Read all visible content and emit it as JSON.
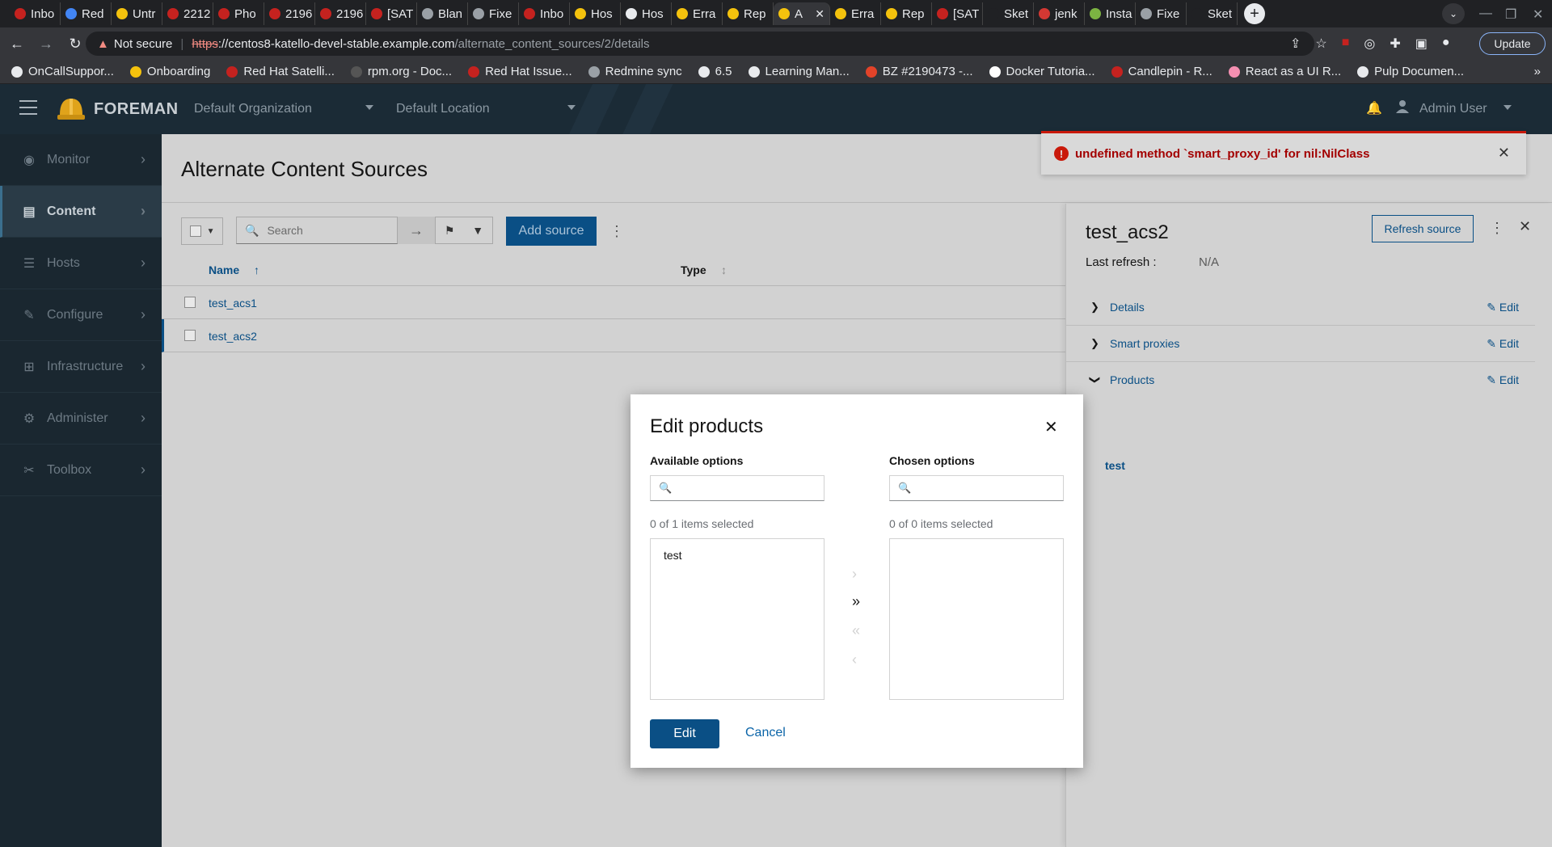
{
  "browser": {
    "tabs": [
      {
        "label": "Inbo",
        "color": "#c5221f"
      },
      {
        "label": "Red",
        "color": "#4285f4"
      },
      {
        "label": "Untr",
        "color": "#f4c20d"
      },
      {
        "label": "2212",
        "color": "#c5221f"
      },
      {
        "label": "Pho",
        "color": "#c5221f"
      },
      {
        "label": "2196",
        "color": "#c5221f"
      },
      {
        "label": "2196",
        "color": "#c5221f"
      },
      {
        "label": "[SAT",
        "color": "#c5221f"
      },
      {
        "label": "Blan",
        "color": "#9aa0a6"
      },
      {
        "label": "Fixe",
        "color": "#9aa0a6"
      },
      {
        "label": "Inbo",
        "color": "#c5221f"
      },
      {
        "label": "Hos",
        "color": "#f4c20d"
      },
      {
        "label": "Hos",
        "color": "#e8eaed"
      },
      {
        "label": "Erra",
        "color": "#f4c20d"
      },
      {
        "label": "Rep",
        "color": "#f4c20d"
      },
      {
        "label": "A",
        "color": "#f4c20d",
        "active": true
      },
      {
        "label": "Erra",
        "color": "#f4c20d"
      },
      {
        "label": "Rep",
        "color": "#f4c20d"
      },
      {
        "label": "[SAT",
        "color": "#c5221f"
      },
      {
        "label": "Sket",
        "color": "#202124"
      },
      {
        "label": "jenk",
        "color": "#d33833"
      },
      {
        "label": "Insta",
        "color": "#7cb342"
      },
      {
        "label": "Fixe",
        "color": "#9aa0a6"
      },
      {
        "label": "Sket",
        "color": "#202124"
      }
    ],
    "new_tab": "+",
    "address": {
      "warning": "Not secure",
      "scheme": "https",
      "host": "://centos8-katello-devel-stable.example.com",
      "path": "/alternate_content_sources/2/details"
    },
    "update_label": "Update",
    "bookmarks": [
      {
        "label": "OnCallSuppor...",
        "color": "#e8eaed"
      },
      {
        "label": "Onboarding",
        "color": "#f4c20d"
      },
      {
        "label": "Red Hat Satelli...",
        "color": "#c5221f"
      },
      {
        "label": "rpm.org - Doc...",
        "color": "#555"
      },
      {
        "label": "Red Hat Issue...",
        "color": "#c5221f"
      },
      {
        "label": "Redmine sync",
        "color": "#9aa0a6"
      },
      {
        "label": "6.5",
        "color": "#e8eaed"
      },
      {
        "label": "Learning Man...",
        "color": "#e8eaed"
      },
      {
        "label": "BZ #2190473 -...",
        "color": "#e24329"
      },
      {
        "label": "Docker Tutoria...",
        "color": "#ffffff"
      },
      {
        "label": "Candlepin - R...",
        "color": "#c5221f"
      },
      {
        "label": "React as a UI R...",
        "color": "#f48fb1"
      },
      {
        "label": "Pulp Documen...",
        "color": "#e8eaed"
      }
    ],
    "bookmarks_more": "»"
  },
  "app": {
    "brand": "FOREMAN",
    "organization": "Default Organization",
    "location": "Default Location",
    "user": "Admin User"
  },
  "sidebar": {
    "items": [
      {
        "label": "Monitor",
        "icon": "dashboard-icon",
        "glyph": "◉"
      },
      {
        "label": "Content",
        "icon": "book-icon",
        "glyph": "▤",
        "active": true
      },
      {
        "label": "Hosts",
        "icon": "server-icon",
        "glyph": "☰"
      },
      {
        "label": "Configure",
        "icon": "wrench-icon",
        "glyph": "✎"
      },
      {
        "label": "Infrastructure",
        "icon": "network-icon",
        "glyph": "⊞"
      },
      {
        "label": "Administer",
        "icon": "gear-icon",
        "glyph": "⚙"
      },
      {
        "label": "Toolbox",
        "icon": "tools-icon",
        "glyph": "✂"
      }
    ]
  },
  "page": {
    "title": "Alternate Content Sources",
    "search_placeholder": "Search",
    "add_source_label": "Add source",
    "columns": {
      "name": "Name",
      "type": "Type"
    },
    "rows": [
      {
        "name": "test_acs1"
      },
      {
        "name": "test_acs2"
      }
    ]
  },
  "drawer": {
    "title": "test_acs2",
    "refresh_label": "Refresh source",
    "last_refresh_label": "Last refresh :",
    "last_refresh_value": "N/A",
    "sections": [
      {
        "label": "Details",
        "edit": "Edit",
        "expanded": false
      },
      {
        "label": "Smart proxies",
        "edit": "Edit",
        "expanded": false
      },
      {
        "label": "Products",
        "edit": "Edit",
        "expanded": true
      }
    ],
    "product": "test"
  },
  "toast": {
    "message": "undefined method `smart_proxy_id' for nil:NilClass"
  },
  "modal": {
    "title": "Edit products",
    "available_label": "Available options",
    "chosen_label": "Chosen options",
    "available_count": "0 of 1 items selected",
    "chosen_count": "0 of 0 items selected",
    "available_items": [
      "test"
    ],
    "edit_label": "Edit",
    "cancel_label": "Cancel"
  }
}
